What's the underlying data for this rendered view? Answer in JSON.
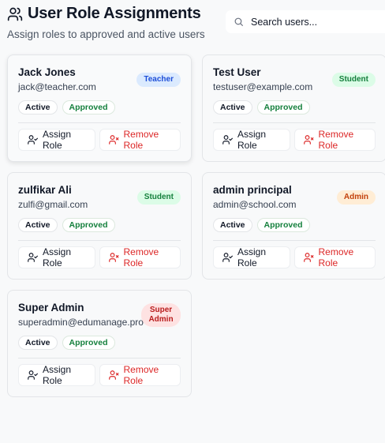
{
  "header": {
    "title": "User Role Assignments",
    "subtitle": "Assign roles to approved and active users"
  },
  "search": {
    "placeholder": "Search users..."
  },
  "labels": {
    "assign": "Assign Role",
    "remove": "Remove Role"
  },
  "users": [
    {
      "name": "Jack Jones",
      "email": "jack@teacher.com",
      "role": "Teacher",
      "status": "Active",
      "approval": "Approved",
      "role_color": "#dbeafe",
      "role_text_color": "#1d4ed8"
    },
    {
      "name": "Test User",
      "email": "testuser@example.com",
      "role": "Student",
      "status": "Active",
      "approval": "Approved",
      "role_color": "#dcfce7",
      "role_text_color": "#15803d"
    },
    {
      "name": "zulfikar Ali",
      "email": "zulfi@gmail.com",
      "role": "Student",
      "status": "Active",
      "approval": "Approved",
      "role_color": "#dcfce7",
      "role_text_color": "#15803d"
    },
    {
      "name": "admin principal",
      "email": "admin@school.com",
      "role": "Admin",
      "status": "Active",
      "approval": "Approved",
      "role_color": "#ffedd5",
      "role_text_color": "#c2410c"
    },
    {
      "name": "Super Admin",
      "email": "superadmin@edumanage.pro",
      "role": "Super Admin",
      "status": "Active",
      "approval": "Approved",
      "role_color": "#fee2e2",
      "role_text_color": "#b91c1c"
    }
  ]
}
